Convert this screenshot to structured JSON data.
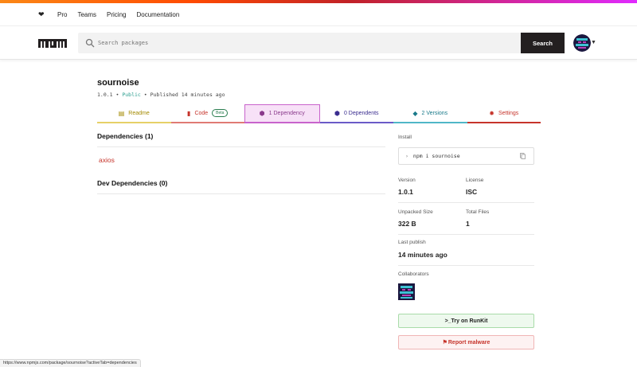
{
  "topnav": {
    "heart": "❤",
    "links": [
      "Pro",
      "Teams",
      "Pricing",
      "Documentation"
    ]
  },
  "header": {
    "logo": "npm",
    "search_placeholder": "Search packages",
    "search_button": "Search"
  },
  "package": {
    "name": "sournoise",
    "version": "1.0.1",
    "sep1": "•",
    "visibility": "Public",
    "sep2": "•",
    "published": "Published 14 minutes ago"
  },
  "tabs": [
    {
      "label": "Readme",
      "icon": "readme-icon"
    },
    {
      "label": "Code",
      "badge": "Beta",
      "icon": "code-icon"
    },
    {
      "label": "1 Dependency",
      "icon": "dependency-icon",
      "active": true
    },
    {
      "label": "0 Dependents",
      "icon": "dependents-icon"
    },
    {
      "label": "2 Versions",
      "icon": "versions-icon"
    },
    {
      "label": "Settings",
      "icon": "settings-icon"
    }
  ],
  "main": {
    "dependencies_heading": "Dependencies (1)",
    "dependencies": [
      "axios"
    ],
    "dev_dependencies_heading": "Dev Dependencies (0)"
  },
  "sidebar": {
    "install_label": "Install",
    "install_cmd": "npm i sournoise",
    "version_label": "Version",
    "version_value": "1.0.1",
    "license_label": "License",
    "license_value": "ISC",
    "unpacked_label": "Unpacked Size",
    "unpacked_value": "322 B",
    "files_label": "Total Files",
    "files_value": "1",
    "last_publish_label": "Last publish",
    "last_publish_value": "14 minutes ago",
    "collaborators_label": "Collaborators",
    "runkit_label": ">_Try on RunKit",
    "report_label": "Report malware"
  },
  "statusbar": {
    "url": "https://www.npmjs.com/package/sournoise?activeTab=dependencies"
  },
  "colors": {
    "accent_red": "#c6342b",
    "dark": "#231f20"
  }
}
